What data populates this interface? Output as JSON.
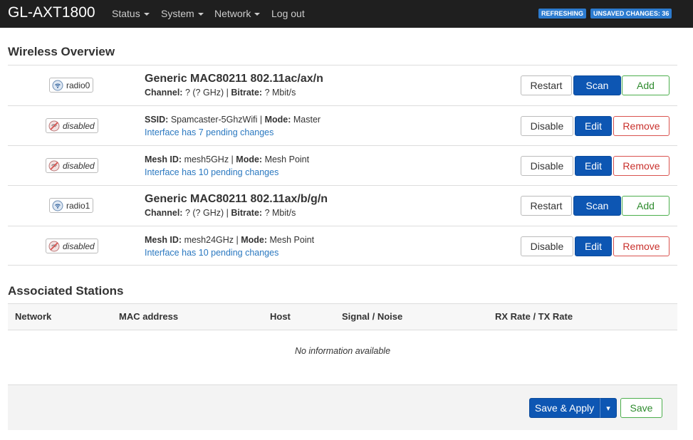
{
  "header": {
    "brand": "GL-AXT1800",
    "menu": [
      "Status",
      "System",
      "Network",
      "Log out"
    ],
    "badges": {
      "refreshing": "REFRESHING",
      "unsaved": "UNSAVED CHANGES: 36"
    }
  },
  "wireless": {
    "heading": "Wireless Overview",
    "rows": [
      {
        "chip": "radio0",
        "title": "Generic MAC80211 802.11ac/ax/n",
        "l1_label": "Channel:",
        "l1_val": " ? (? GHz) | ",
        "l2_label": "Bitrate:",
        "l2_val": " ? Mbit/s",
        "buttons": [
          "Restart",
          "Scan",
          "Add"
        ]
      },
      {
        "chip": "disabled",
        "l1_label": "SSID:",
        "l1_val": " Spamcaster-5GhzWifi | ",
        "l2_label": "Mode:",
        "l2_val": " Master",
        "pending": "Interface has 7 pending changes",
        "buttons": [
          "Disable",
          "Edit",
          "Remove"
        ]
      },
      {
        "chip": "disabled",
        "l1_label": "Mesh ID:",
        "l1_val": " mesh5GHz | ",
        "l2_label": "Mode:",
        "l2_val": " Mesh Point",
        "pending": "Interface has 10 pending changes",
        "buttons": [
          "Disable",
          "Edit",
          "Remove"
        ]
      },
      {
        "chip": "radio1",
        "title": "Generic MAC80211 802.11ax/b/g/n",
        "l1_label": "Channel:",
        "l1_val": " ? (? GHz) | ",
        "l2_label": "Bitrate:",
        "l2_val": " ? Mbit/s",
        "buttons": [
          "Restart",
          "Scan",
          "Add"
        ]
      },
      {
        "chip": "disabled",
        "l1_label": "Mesh ID:",
        "l1_val": " mesh24GHz | ",
        "l2_label": "Mode:",
        "l2_val": " Mesh Point",
        "pending": "Interface has 10 pending changes",
        "buttons": [
          "Disable",
          "Edit",
          "Remove"
        ]
      }
    ]
  },
  "stations": {
    "heading": "Associated Stations",
    "columns": [
      "Network",
      "MAC address",
      "Host",
      "Signal / Noise",
      "RX Rate / TX Rate"
    ],
    "empty": "No information available"
  },
  "footer": {
    "save_apply": "Save & Apply",
    "dropdown": "▾",
    "save": "Save"
  },
  "icons": {
    "radio": "wifi-radio-icon",
    "disabled": "wifi-disabled-icon",
    "caret": "caret-down-icon"
  },
  "colors": {
    "topbar": "#1f1f1f",
    "badge": "#2c7bcf",
    "primary": "#0d56b3",
    "link": "#2a78c0",
    "add": "#4cae4c",
    "remove": "#d9534f"
  }
}
